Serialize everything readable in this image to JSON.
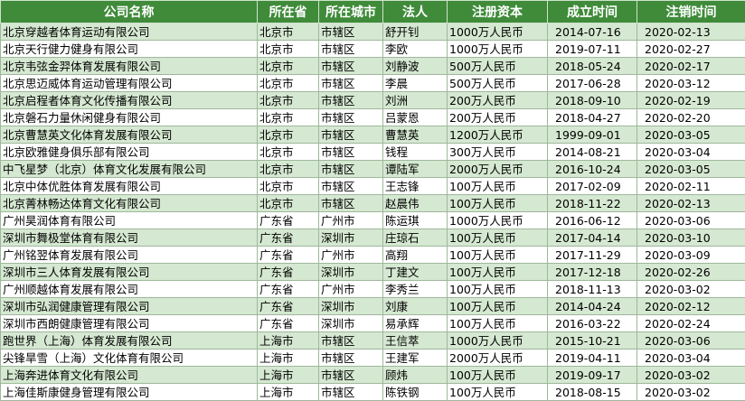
{
  "columns": [
    "公司名称",
    "所在省",
    "所在城市",
    "法人",
    "注册资本",
    "成立时间",
    "注销时间"
  ],
  "rows": [
    [
      "北京穿越者体育运动有限公司",
      "北京市",
      "市辖区",
      "舒开钊",
      "1000万人民币",
      "2014-07-16",
      "2020-02-13"
    ],
    [
      "北京天行健力健身有限公司",
      "北京市",
      "市辖区",
      "李欧",
      "1000万人民币",
      "2019-07-11",
      "2020-02-27"
    ],
    [
      "北京韦弦金羿体育发展有限公司",
      "北京市",
      "市辖区",
      "刘静波",
      "500万人民币",
      "2018-05-24",
      "2020-02-17"
    ],
    [
      "北京思迈威体育运动管理有限公司",
      "北京市",
      "市辖区",
      "李晨",
      "500万人民币",
      "2017-06-28",
      "2020-03-12"
    ],
    [
      "北京启程者体育文化传播有限公司",
      "北京市",
      "市辖区",
      "刘洲",
      "200万人民币",
      "2018-09-10",
      "2020-02-19"
    ],
    [
      "北京磐石力量休闲健身有限公司",
      "北京市",
      "市辖区",
      "吕蒙恩",
      "200万人民币",
      "2018-04-27",
      "2020-02-20"
    ],
    [
      "北京曹慧英文化体育发展有限公司",
      "北京市",
      "市辖区",
      "曹慧英",
      "1200万人民币",
      "1999-09-01",
      "2020-03-05"
    ],
    [
      "北京欧雅健身俱乐部有限公司",
      "北京市",
      "市辖区",
      "钱程",
      "300万人民币",
      "2014-08-21",
      "2020-03-04"
    ],
    [
      "中飞星梦（北京）体育文化发展有限公司",
      "北京市",
      "市辖区",
      "谭陆军",
      "2000万人民币",
      "2016-10-24",
      "2020-03-05"
    ],
    [
      "北京中体优胜体育发展有限公司",
      "北京市",
      "市辖区",
      "王志锋",
      "100万人民币",
      "2017-02-09",
      "2020-02-11"
    ],
    [
      "北京菁林畅达体育文化有限公司",
      "北京市",
      "市辖区",
      "赵晨伟",
      "100万人民币",
      "2018-11-22",
      "2020-02-13"
    ],
    [
      "广州昊润体育有限公司",
      "广东省",
      "广州市",
      "陈运琪",
      "1000万人民币",
      "2016-06-12",
      "2020-03-06"
    ],
    [
      "深圳市舞极堂体育有限公司",
      "广东省",
      "深圳市",
      "庄琼石",
      "100万人民币",
      "2017-04-14",
      "2020-03-10"
    ],
    [
      "广州铭翌体育发展有限公司",
      "广东省",
      "广州市",
      "高翔",
      "100万人民币",
      "2017-11-29",
      "2020-03-09"
    ],
    [
      "深圳市三人体育发展有限公司",
      "广东省",
      "深圳市",
      "丁建文",
      "100万人民币",
      "2017-12-18",
      "2020-02-26"
    ],
    [
      "广州顺越体育发展有限公司",
      "广东省",
      "广州市",
      "李秀兰",
      "100万人民币",
      "2018-11-13",
      "2020-03-02"
    ],
    [
      "深圳市弘润健康管理有限公司",
      "广东省",
      "深圳市",
      "刘康",
      "100万人民币",
      "2014-04-24",
      "2020-02-12"
    ],
    [
      "深圳市西朗健康管理有限公司",
      "广东省",
      "深圳市",
      "易承辉",
      "100万人民币",
      "2016-03-22",
      "2020-02-24"
    ],
    [
      "跑世界（上海）体育发展有限公司",
      "上海市",
      "市辖区",
      "王信萃",
      "1000万人民币",
      "2015-10-21",
      "2020-03-06"
    ],
    [
      "尖锋旱雪（上海）文化体育有限公司",
      "上海市",
      "市辖区",
      "王建军",
      "2000万人民币",
      "2019-04-11",
      "2020-03-04"
    ],
    [
      "上海奔进体育文化有限公司",
      "上海市",
      "市辖区",
      "顾炜",
      "100万人民币",
      "2019-09-17",
      "2020-03-02"
    ],
    [
      "上海佳斯康健身管理有限公司",
      "上海市",
      "市辖区",
      "陈铁钢",
      "100万人民币",
      "2018-08-15",
      "2020-03-02"
    ]
  ]
}
